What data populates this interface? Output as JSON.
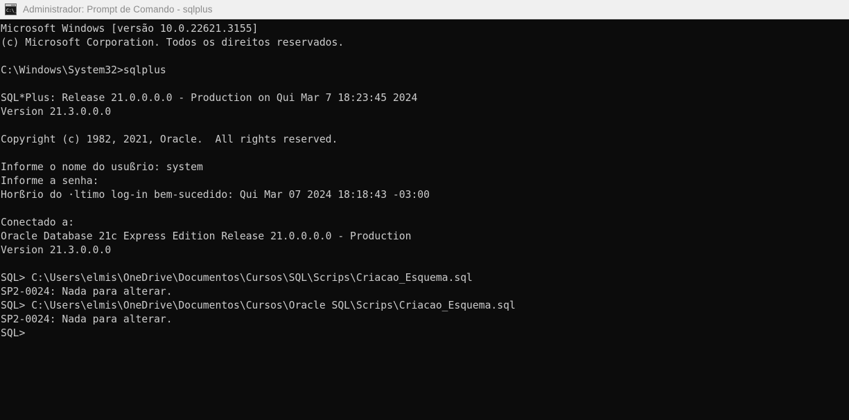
{
  "window": {
    "title": "Administrador: Prompt de Comando - sqlplus",
    "icon": "console-window-icon",
    "titlebar_bg": "#f0f0f0",
    "titlebar_text_color": "#8a8a8a"
  },
  "console": {
    "background": "#0c0c0c",
    "foreground": "#cccccc",
    "prompt": "SQL>",
    "lines": [
      "Microsoft Windows [versão 10.0.22621.3155]",
      "(c) Microsoft Corporation. Todos os direitos reservados.",
      "",
      "C:\\Windows\\System32>sqlplus",
      "",
      "SQL*Plus: Release 21.0.0.0.0 - Production on Qui Mar 7 18:23:45 2024",
      "Version 21.3.0.0.0",
      "",
      "Copyright (c) 1982, 2021, Oracle.  All rights reserved.",
      "",
      "Informe o nome do usußrio: system",
      "Informe a senha:",
      "Horßrio do ·ltimo log-in bem-sucedido: Qui Mar 07 2024 18:18:43 -03:00",
      "",
      "Conectado a:",
      "Oracle Database 21c Express Edition Release 21.0.0.0.0 - Production",
      "Version 21.3.0.0.0",
      "",
      "SQL> C:\\Users\\elmis\\OneDrive\\Documentos\\Cursos\\SQL\\Scrips\\Criacao_Esquema.sql",
      "SP2-0024: Nada para alterar.",
      "SQL> C:\\Users\\elmis\\OneDrive\\Documentos\\Cursos\\Oracle SQL\\Scrips\\Criacao_Esquema.sql",
      "SP2-0024: Nada para alterar.",
      "SQL>"
    ]
  }
}
